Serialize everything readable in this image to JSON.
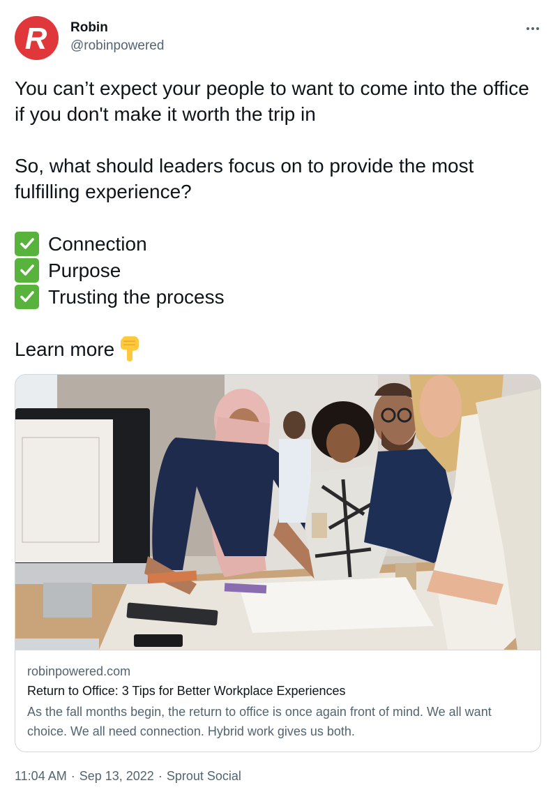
{
  "author": {
    "display_name": "Robin",
    "handle": "@robinpowered",
    "avatar_letter": "R",
    "avatar_color": "#e0383a"
  },
  "more_icon": "more-horizontal-icon",
  "tweet": {
    "intro": "You can’t expect your people to want to come into the office if you don't make it worth the trip in",
    "question": "So, what should leaders focus on to provide the most fulfilling experience?",
    "checklist": [
      "Connection",
      "Purpose",
      "Trusting the process"
    ],
    "checklist_icon": "check-mark-button-icon",
    "cta": "Learn more",
    "cta_icon": "backhand-index-pointing-down-icon"
  },
  "card": {
    "image_alt": "photo-of-coworkers-reviewing-plans",
    "domain": "robinpowered.com",
    "title": "Return to Office: 3 Tips for Better Workplace Experiences",
    "description": "As the fall months begin, the return to office is once again front of mind. We all want choice. We all need connection. Hybrid work gives us both."
  },
  "meta": {
    "time": "11:04 AM",
    "separator": "·",
    "date": "Sep 13, 2022",
    "source": "Sprout Social"
  },
  "colors": {
    "text_primary": "#0f1419",
    "text_secondary": "#536471",
    "border": "#cfd9de",
    "check_green": "#58b33c"
  }
}
